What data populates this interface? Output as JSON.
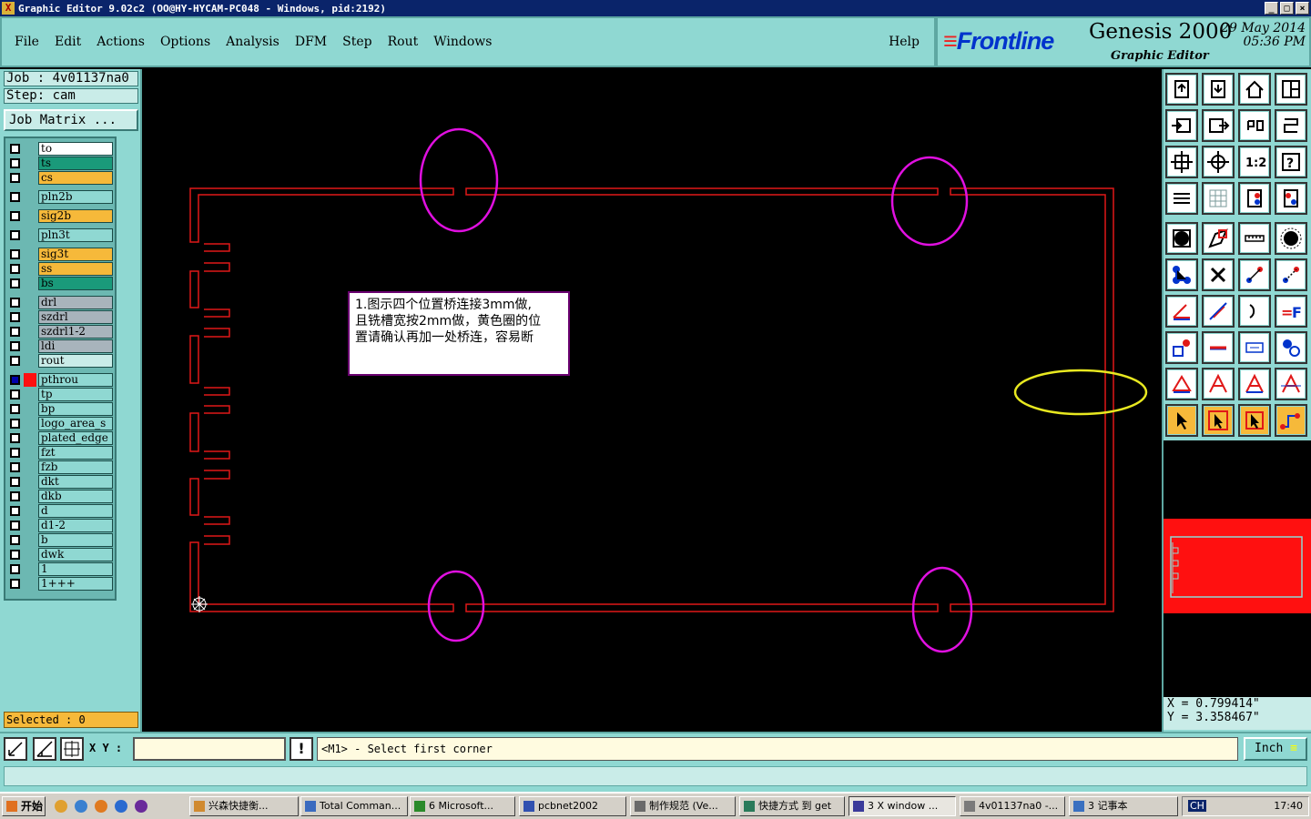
{
  "window": {
    "title": "Graphic Editor 9.02c2  (OO@HY-HYCAM-PC048 - Windows, pid:2192)",
    "buttons": [
      "_",
      "□",
      "×"
    ]
  },
  "menu": {
    "items": [
      "File",
      "Edit",
      "Actions",
      "Options",
      "Analysis",
      "DFM",
      "Step",
      "Rout",
      "Windows"
    ],
    "help": "Help"
  },
  "brand": {
    "logo": "Frontline",
    "product": "Genesis 2000",
    "subtitle": "Graphic Editor",
    "date_line1": "29 May 2014",
    "date_line2": "05:36 PM"
  },
  "job": {
    "job_line": "Job : 4v01137na0",
    "step_line": "Step: cam",
    "matrix_button": "Job Matrix ..."
  },
  "layers": [
    {
      "name": "to",
      "color": "#ffffff"
    },
    {
      "name": "ts",
      "color": "#1a9a7a"
    },
    {
      "name": "cs",
      "color": "#f6b93a"
    },
    {
      "name": "pln2b",
      "color": "#8fd8d2"
    },
    {
      "name": "sig2b",
      "color": "#f6b93a"
    },
    {
      "name": "pln3t",
      "color": "#8fd8d2"
    },
    {
      "name": "sig3t",
      "color": "#f6b93a"
    },
    {
      "name": "ss",
      "color": "#f6b93a"
    },
    {
      "name": "bs",
      "color": "#1a9a7a"
    },
    {
      "name": "drl",
      "color": "#a8b4bc"
    },
    {
      "name": "szdrl",
      "color": "#a8b4bc"
    },
    {
      "name": "szdrl1-2",
      "color": "#a8b4bc"
    },
    {
      "name": "ldi",
      "color": "#a8b4bc"
    },
    {
      "name": "rout",
      "color": "#c9ece8"
    },
    {
      "name": "pthrou",
      "color": "#8fd8d2"
    },
    {
      "name": "tp",
      "color": "#8fd8d2"
    },
    {
      "name": "bp",
      "color": "#8fd8d2"
    },
    {
      "name": "logo_area_s",
      "color": "#8fd8d2"
    },
    {
      "name": "plated_edge",
      "color": "#8fd8d2"
    },
    {
      "name": "fzt",
      "color": "#8fd8d2"
    },
    {
      "name": "fzb",
      "color": "#8fd8d2"
    },
    {
      "name": "dkt",
      "color": "#8fd8d2"
    },
    {
      "name": "dkb",
      "color": "#8fd8d2"
    },
    {
      "name": "d",
      "color": "#8fd8d2"
    },
    {
      "name": "d1-2",
      "color": "#8fd8d2"
    },
    {
      "name": "b",
      "color": "#8fd8d2"
    },
    {
      "name": "dwk",
      "color": "#8fd8d2"
    },
    {
      "name": "1",
      "color": "#8fd8d2"
    },
    {
      "name": "1+++",
      "color": "#8fd8d2"
    }
  ],
  "selected": "Selected : 0",
  "annotation": {
    "line1": "1.图示四个位置桥连接3mm做,",
    "line2": "且铣槽宽按2mm做，黄色圈的位",
    "line3": "置请确认再加一处桥连，容易断"
  },
  "coords": {
    "x": "X = 0.799414\"",
    "y": "Y = 3.358467\""
  },
  "command": {
    "xy_label": "X Y :",
    "xy_value": "",
    "prompt": "<M1> - Select first corner",
    "units": "Inch"
  },
  "taskbar": {
    "start": "开始",
    "buttons": [
      "兴森快捷衡...",
      "Total Comman...",
      "6 Microsoft...",
      "pcbnet2002",
      "制作规范 (Ve...",
      "快捷方式 到 get",
      "3 X window ...",
      "4v01137na0 -...",
      "3 记事本"
    ],
    "lang": "CH",
    "clock": "17:40"
  },
  "colors": {
    "panel": "#8fd8d2",
    "outline": "#e01818",
    "bridge_circle": "#e010e0",
    "attention_circle": "#e8e820"
  }
}
